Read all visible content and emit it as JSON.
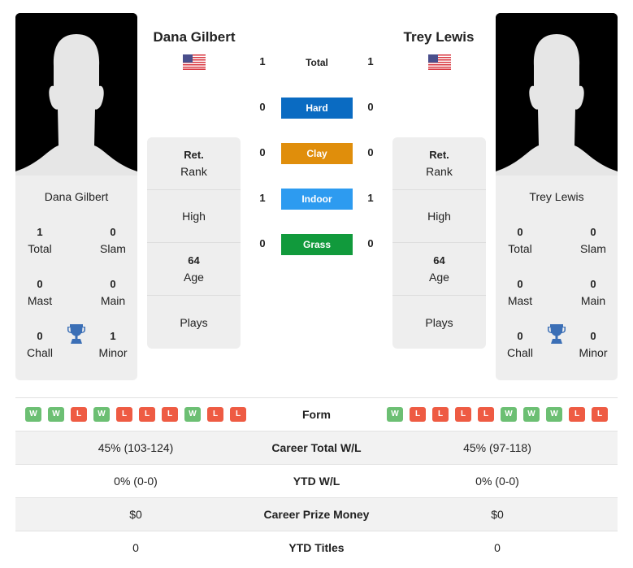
{
  "players": [
    {
      "name": "Dana Gilbert",
      "flag": "us-flag",
      "titles": {
        "total": "1",
        "slam": "0",
        "mast": "0",
        "main": "0",
        "chall": "0",
        "minor": "1"
      },
      "stats": {
        "rank_value": "Ret.",
        "high_value": "",
        "age_value": "64",
        "plays_value": ""
      },
      "form": [
        "W",
        "W",
        "L",
        "W",
        "L",
        "L",
        "L",
        "W",
        "L",
        "L"
      ],
      "career_wl": "45% (103-124)",
      "ytd_wl": "0% (0-0)",
      "prize": "$0",
      "ytd_titles": "0"
    },
    {
      "name": "Trey Lewis",
      "flag": "us-flag",
      "titles": {
        "total": "0",
        "slam": "0",
        "mast": "0",
        "main": "0",
        "chall": "0",
        "minor": "0"
      },
      "stats": {
        "rank_value": "Ret.",
        "high_value": "",
        "age_value": "64",
        "plays_value": ""
      },
      "form": [
        "W",
        "L",
        "L",
        "L",
        "L",
        "W",
        "W",
        "W",
        "L",
        "L"
      ],
      "career_wl": "45% (97-118)",
      "ytd_wl": "0% (0-0)",
      "prize": "$0",
      "ytd_titles": "0"
    }
  ],
  "labels": {
    "total": "Total",
    "slam": "Slam",
    "mast": "Mast",
    "main": "Main",
    "chall": "Chall",
    "minor": "Minor",
    "rank": "Rank",
    "high": "High",
    "age": "Age",
    "plays": "Plays",
    "form": "Form",
    "career_wl": "Career Total W/L",
    "ytd_wl": "YTD W/L",
    "prize": "Career Prize Money",
    "ytd_titles": "YTD Titles"
  },
  "h2h": {
    "total": {
      "label": "Total",
      "left": "1",
      "right": "1"
    },
    "surfaces": [
      {
        "label": "Hard",
        "left": "0",
        "right": "0",
        "color": "#0a6bc2"
      },
      {
        "label": "Clay",
        "left": "0",
        "right": "0",
        "color": "#e08e0b"
      },
      {
        "label": "Indoor",
        "left": "1",
        "right": "1",
        "color": "#2d9bf0"
      },
      {
        "label": "Grass",
        "left": "0",
        "right": "0",
        "color": "#119a3c"
      }
    ]
  },
  "colors": {
    "win": "#6cbf73",
    "loss": "#ee5b43",
    "trophy": "#3b6fb6"
  }
}
